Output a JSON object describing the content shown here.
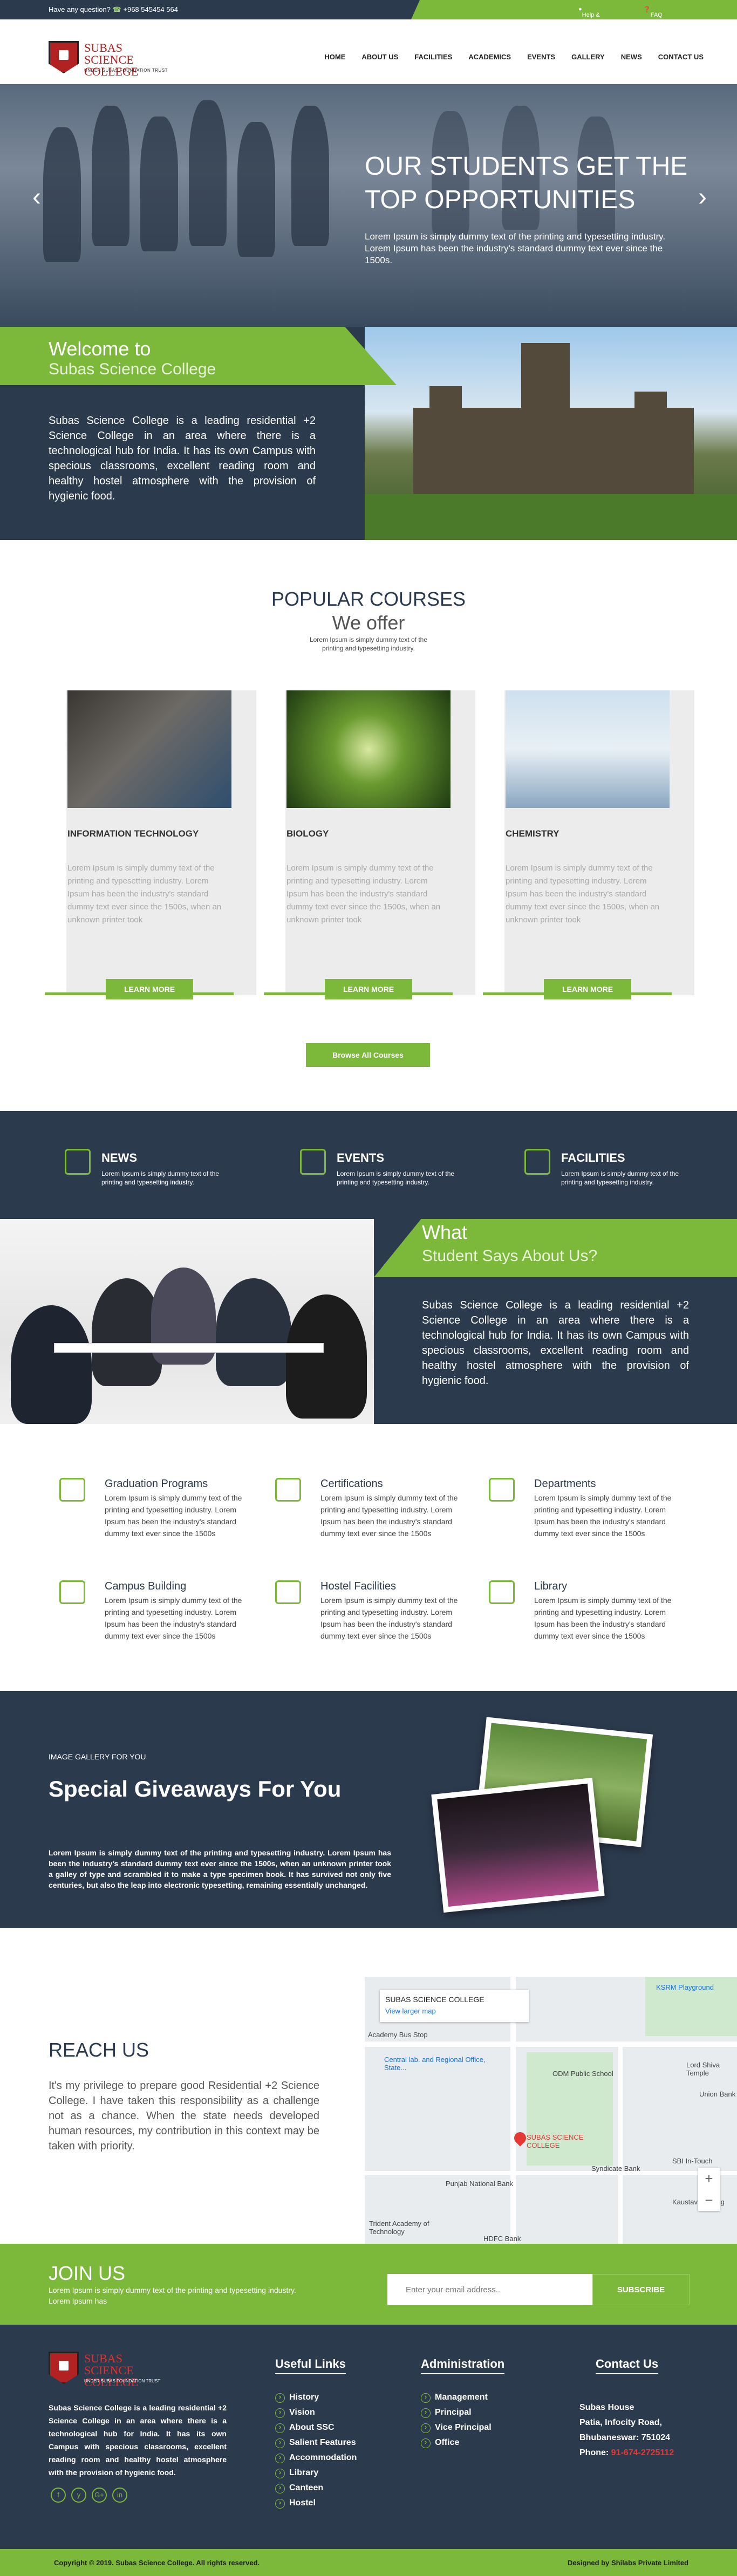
{
  "topbar": {
    "question": "Have any question?",
    "phone": "+968 545454 564",
    "help": "Help & Support",
    "faq": "FAQ"
  },
  "logo": {
    "line1": "SUBAS",
    "line2": "SCIENCE COLLEGE",
    "line3": "UNDER SUBAS FOUNDATION TRUST"
  },
  "nav": [
    "HOME",
    "ABOUT US",
    "FACILITIES",
    "ACADEMICS",
    "EVENTS",
    "GALLERY",
    "NEWS",
    "CONTACT US"
  ],
  "hero": {
    "title": "OUR STUDENTS GET THE TOP OPPORTUNITIES",
    "text": "Lorem Ipsum is simply dummy text of the printing and typesetting industry. Lorem Ipsum has been the industry's standard dummy text ever since the 1500s."
  },
  "welcome": {
    "title1": "Welcome to",
    "title2": "Subas Science College",
    "text": "Subas Science College is a leading residential +2 Science College in an area where there is a technological hub for India. It has its own Campus with specious classrooms, excellent reading room and healthy hostel atmosphere with the provision of hygienic food."
  },
  "courses": {
    "title": "POPULAR COURSES",
    "subtitle": "We offer",
    "desc": "Lorem Ipsum is simply dummy text of the printing and typesetting industry.",
    "items": [
      {
        "name": "INFORMATION TECHNOLOGY",
        "text": "Lorem Ipsum is simply dummy text of the printing and typesetting industry. Lorem Ipsum has been the industry's standard dummy text ever since the 1500s, when an unknown printer took",
        "button": "LEARN MORE"
      },
      {
        "name": "BIOLOGY",
        "text": "Lorem Ipsum is simply dummy text of the printing and typesetting industry. Lorem Ipsum has been the industry's standard dummy text ever since the 1500s, when an unknown printer took",
        "button": "LEARN MORE"
      },
      {
        "name": "CHEMISTRY",
        "text": "Lorem Ipsum is simply dummy text of the printing and typesetting industry. Lorem Ipsum has been the industry's standard dummy text ever since the 1500s, when an unknown printer took",
        "button": "LEARN MORE"
      }
    ],
    "browse": "Browse All Courses"
  },
  "features": [
    {
      "title": "NEWS",
      "text": "Lorem Ipsum is simply dummy text of the printing and typesetting industry.",
      "icon": "newspaper-icon"
    },
    {
      "title": "EVENTS",
      "text": "Lorem Ipsum is simply dummy text of the printing and typesetting industry.",
      "icon": "calendar-icon"
    },
    {
      "title": "FACILITIES",
      "text": "Lorem Ipsum is simply dummy text of the printing and typesetting industry.",
      "icon": "home-icon"
    }
  ],
  "testimonial": {
    "title1": "What",
    "title2": "Student Says About Us?",
    "text": "Subas Science College is a leading residential +2 Science College in an area where there is a technological hub for India. It has its own Campus with specious classrooms, excellent reading room and healthy hostel atmosphere with the provision of hygienic food."
  },
  "services": [
    {
      "title": "Graduation Programs",
      "text": "Lorem Ipsum is simply dummy text of the printing and typesetting industry. Lorem Ipsum has been the industry's standard dummy text ever since the 1500s",
      "icon": "graduation-cap-icon"
    },
    {
      "title": "Certifications",
      "text": "Lorem Ipsum is simply dummy text of the printing and typesetting industry. Lorem Ipsum has been the industry's standard dummy text ever since the 1500s",
      "icon": "certificate-icon"
    },
    {
      "title": "Departments",
      "text": "Lorem Ipsum is simply dummy text of the printing and typesetting industry. Lorem Ipsum has been the industry's standard dummy text ever since the 1500s",
      "icon": "departments-icon"
    },
    {
      "title": "Campus Building",
      "text": "Lorem Ipsum is simply dummy text of the printing and typesetting industry. Lorem Ipsum has been the industry's standard dummy text ever since the 1500s",
      "icon": "building-icon"
    },
    {
      "title": "Hostel Facilities",
      "text": "Lorem Ipsum is simply dummy text of the printing and typesetting industry. Lorem Ipsum has been the industry's standard dummy text ever since the 1500s",
      "icon": "hostel-icon"
    },
    {
      "title": "Library",
      "text": "Lorem Ipsum is simply dummy text of the printing and typesetting industry. Lorem Ipsum has been the industry's standard dummy text ever since the 1500s",
      "icon": "library-icon"
    }
  ],
  "gallery": {
    "label": "IMAGE GALLERY FOR YOU",
    "title": "Special  Giveaways For You",
    "text": "Lorem Ipsum is simply dummy text of the printing and typesetting industry. Lorem Ipsum has been the industry's standard dummy text ever since the 1500s, when an unknown printer took a galley of type and scrambled it to make a type specimen book. It has survived not only five centuries, but also the leap into electronic typesetting, remaining essentially unchanged."
  },
  "reach": {
    "title": "REACH US",
    "text": "It's my privilege to prepare good Residential +2 Science College. I have taken this responsibility as a challenge not as a chance. When the state needs developed human resources, my contribution in this context may be taken with priority."
  },
  "map": {
    "place": "SUBAS SCIENCE COLLEGE",
    "link": "View larger map",
    "pin": "SUBAS SCIENCE COLLEGE",
    "labels": [
      "Academy Bus Stop",
      "Central lab. and Regional Office, State...",
      "ODM Public School",
      "Lord Shiva Temple",
      "SBI In-Touch",
      "Syndicate Bank",
      "Punjab National Bank",
      "Kaustav Building",
      "Trident Academy of Technology",
      "KSRM Playground",
      "HDFC Bank",
      "Union Bank"
    ]
  },
  "join": {
    "title": "JOIN US",
    "text": "Lorem Ipsum is simply dummy text of the printing and typesetting industry. Lorem Ipsum has",
    "placeholder": "Enter your email address..",
    "button": "SUBSCRIBE"
  },
  "footer": {
    "about": "Subas Science College is a leading residential +2 Science College in an area where there is a technological hub for India. It has its own Campus with specious classrooms, excellent reading room and healthy hostel atmosphere with the provision of hygienic food.",
    "useful_title": "Useful Links",
    "useful": [
      "History",
      "Vision",
      "About SSC",
      "Salient Features",
      "Accommodation",
      "Library",
      "Canteen",
      "Hostel"
    ],
    "admin_title": "Administration",
    "admin": [
      "Management",
      "Principal",
      "Vice Principal",
      "Office"
    ],
    "contact_title": "Contact Us",
    "address": [
      "Subas House",
      "Patia, Infocity Road,",
      "Bhubaneswar: 751024"
    ],
    "phone_label": "Phone:",
    "phone": "91-674-2725112",
    "social": [
      "f",
      "y",
      "G+",
      "in"
    ]
  },
  "copyright": {
    "left": "Copyright © 2019. Subas Science College. All rights reserved.",
    "right": "Designed by Shilabs Private Limited"
  },
  "colors": {
    "green": "#7cb83a",
    "navy": "#2c3a4e"
  }
}
